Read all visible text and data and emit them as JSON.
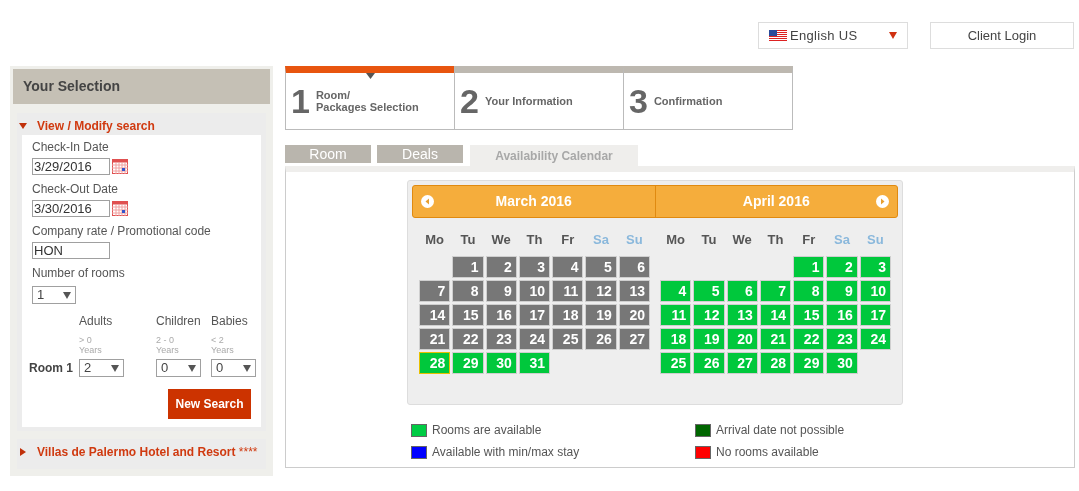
{
  "header": {
    "language": {
      "value": "English US"
    },
    "login_button": "Client Login"
  },
  "sidebar": {
    "title": "Your Selection",
    "sections": [
      {
        "title": "View / Modify search",
        "expanded": true
      },
      {
        "title": "Villas de Palermo Hotel and Resort",
        "suffix": "****",
        "expanded": false
      }
    ],
    "form": {
      "checkin": {
        "label": "Check-In Date",
        "value": "3/29/2016"
      },
      "checkout": {
        "label": "Check-Out Date",
        "value": "3/30/2016"
      },
      "promo": {
        "label": "Company rate / Promotional code",
        "value": "HON"
      },
      "rooms": {
        "label": "Number of rooms",
        "value": "1"
      },
      "guest_columns": [
        {
          "label": "Adults",
          "hint": "> 0",
          "unit": "Years"
        },
        {
          "label": "Children",
          "hint": "2 - 0",
          "unit": "Years"
        },
        {
          "label": "Babies",
          "hint": "< 2",
          "unit": "Years"
        }
      ],
      "room_rows": [
        {
          "label": "Room 1",
          "values": [
            "2",
            "0",
            "0"
          ]
        }
      ],
      "search_button": "New Search"
    }
  },
  "steps": [
    {
      "number": "1",
      "label": "Room/\nPackages Selection",
      "selected": true
    },
    {
      "number": "2",
      "label": "Your Information",
      "selected": false
    },
    {
      "number": "3",
      "label": "Confirmation",
      "selected": false
    }
  ],
  "tabs": [
    {
      "label": "Room",
      "selected": false
    },
    {
      "label": "Deals",
      "selected": false
    },
    {
      "label": "Availability Calendar",
      "selected": true
    }
  ],
  "calendar": {
    "months": [
      {
        "title": "March 2016",
        "prev_button": true,
        "next_button": false,
        "weekdays": [
          {
            "label": "Mo",
            "weekend": false
          },
          {
            "label": "Tu",
            "weekend": false
          },
          {
            "label": "We",
            "weekend": false
          },
          {
            "label": "Th",
            "weekend": false
          },
          {
            "label": "Fr",
            "weekend": false
          },
          {
            "label": "Sa",
            "weekend": true
          },
          {
            "label": "Su",
            "weekend": true
          }
        ],
        "weeks": [
          [
            {
              "kind": "blank"
            },
            {
              "kind": "day",
              "day": "1",
              "available": false,
              "selected": false
            },
            {
              "kind": "day",
              "day": "2",
              "available": false,
              "selected": false
            },
            {
              "kind": "day",
              "day": "3",
              "available": false,
              "selected": false
            },
            {
              "kind": "day",
              "day": "4",
              "available": false,
              "selected": false
            },
            {
              "kind": "day",
              "day": "5",
              "available": false,
              "selected": false
            },
            {
              "kind": "day",
              "day": "6",
              "available": false,
              "selected": false
            }
          ],
          [
            {
              "kind": "day",
              "day": "7",
              "available": false,
              "selected": false
            },
            {
              "kind": "day",
              "day": "8",
              "available": false,
              "selected": false
            },
            {
              "kind": "day",
              "day": "9",
              "available": false,
              "selected": false
            },
            {
              "kind": "day",
              "day": "10",
              "available": false,
              "selected": false
            },
            {
              "kind": "day",
              "day": "11",
              "available": false,
              "selected": false
            },
            {
              "kind": "day",
              "day": "12",
              "available": false,
              "selected": false
            },
            {
              "kind": "day",
              "day": "13",
              "available": false,
              "selected": false
            }
          ],
          [
            {
              "kind": "day",
              "day": "14",
              "available": false,
              "selected": false
            },
            {
              "kind": "day",
              "day": "15",
              "available": false,
              "selected": false
            },
            {
              "kind": "day",
              "day": "16",
              "available": false,
              "selected": false
            },
            {
              "kind": "day",
              "day": "17",
              "available": false,
              "selected": false
            },
            {
              "kind": "day",
              "day": "18",
              "available": false,
              "selected": false
            },
            {
              "kind": "day",
              "day": "19",
              "available": false,
              "selected": false
            },
            {
              "kind": "day",
              "day": "20",
              "available": false,
              "selected": false
            }
          ],
          [
            {
              "kind": "day",
              "day": "21",
              "available": false,
              "selected": false
            },
            {
              "kind": "day",
              "day": "22",
              "available": false,
              "selected": false
            },
            {
              "kind": "day",
              "day": "23",
              "available": false,
              "selected": false
            },
            {
              "kind": "day",
              "day": "24",
              "available": false,
              "selected": false
            },
            {
              "kind": "day",
              "day": "25",
              "available": false,
              "selected": false
            },
            {
              "kind": "day",
              "day": "26",
              "available": false,
              "selected": false
            },
            {
              "kind": "day",
              "day": "27",
              "available": false,
              "selected": false
            }
          ],
          [
            {
              "kind": "day",
              "day": "28",
              "available": true,
              "selected": true
            },
            {
              "kind": "day",
              "day": "29",
              "available": true,
              "selected": false
            },
            {
              "kind": "day",
              "day": "30",
              "available": true,
              "selected": false
            },
            {
              "kind": "day",
              "day": "31",
              "available": true,
              "selected": false
            }
          ]
        ]
      },
      {
        "title": "April 2016",
        "prev_button": false,
        "next_button": true,
        "weekdays": [
          {
            "label": "Mo",
            "weekend": false
          },
          {
            "label": "Tu",
            "weekend": false
          },
          {
            "label": "We",
            "weekend": false
          },
          {
            "label": "Th",
            "weekend": false
          },
          {
            "label": "Fr",
            "weekend": false
          },
          {
            "label": "Sa",
            "weekend": true
          },
          {
            "label": "Su",
            "weekend": true
          }
        ],
        "weeks": [
          [
            {
              "kind": "blank"
            },
            {
              "kind": "blank"
            },
            {
              "kind": "blank"
            },
            {
              "kind": "blank"
            },
            {
              "kind": "day",
              "day": "1",
              "available": true,
              "selected": false
            },
            {
              "kind": "day",
              "day": "2",
              "available": true,
              "selected": false
            },
            {
              "kind": "day",
              "day": "3",
              "available": true,
              "selected": false
            }
          ],
          [
            {
              "kind": "day",
              "day": "4",
              "available": true,
              "selected": false
            },
            {
              "kind": "day",
              "day": "5",
              "available": true,
              "selected": false
            },
            {
              "kind": "day",
              "day": "6",
              "available": true,
              "selected": false
            },
            {
              "kind": "day",
              "day": "7",
              "available": true,
              "selected": false
            },
            {
              "kind": "day",
              "day": "8",
              "available": true,
              "selected": false
            },
            {
              "kind": "day",
              "day": "9",
              "available": true,
              "selected": false
            },
            {
              "kind": "day",
              "day": "10",
              "available": true,
              "selected": false
            }
          ],
          [
            {
              "kind": "day",
              "day": "11",
              "available": true,
              "selected": false
            },
            {
              "kind": "day",
              "day": "12",
              "available": true,
              "selected": false
            },
            {
              "kind": "day",
              "day": "13",
              "available": true,
              "selected": false
            },
            {
              "kind": "day",
              "day": "14",
              "available": true,
              "selected": false
            },
            {
              "kind": "day",
              "day": "15",
              "available": true,
              "selected": false
            },
            {
              "kind": "day",
              "day": "16",
              "available": true,
              "selected": false
            },
            {
              "kind": "day",
              "day": "17",
              "available": true,
              "selected": false
            }
          ],
          [
            {
              "kind": "day",
              "day": "18",
              "available": true,
              "selected": false
            },
            {
              "kind": "day",
              "day": "19",
              "available": true,
              "selected": false
            },
            {
              "kind": "day",
              "day": "20",
              "available": true,
              "selected": false
            },
            {
              "kind": "day",
              "day": "21",
              "available": true,
              "selected": false
            },
            {
              "kind": "day",
              "day": "22",
              "available": true,
              "selected": false
            },
            {
              "kind": "day",
              "day": "23",
              "available": true,
              "selected": false
            },
            {
              "kind": "day",
              "day": "24",
              "available": true,
              "selected": false
            }
          ],
          [
            {
              "kind": "day",
              "day": "25",
              "available": true,
              "selected": false
            },
            {
              "kind": "day",
              "day": "26",
              "available": true,
              "selected": false
            },
            {
              "kind": "day",
              "day": "27",
              "available": true,
              "selected": false
            },
            {
              "kind": "day",
              "day": "28",
              "available": true,
              "selected": false
            },
            {
              "kind": "day",
              "day": "29",
              "available": true,
              "selected": false
            },
            {
              "kind": "day",
              "day": "30",
              "available": true,
              "selected": false
            }
          ]
        ]
      }
    ]
  },
  "legend": [
    {
      "label": "Rooms are available",
      "color": "#00cc44"
    },
    {
      "label": "Arrival date not possible",
      "color": "#006600"
    },
    {
      "label": "Available with min/max stay",
      "color": "#0000ff"
    },
    {
      "label": "No rooms available",
      "color": "#ff0000"
    }
  ]
}
